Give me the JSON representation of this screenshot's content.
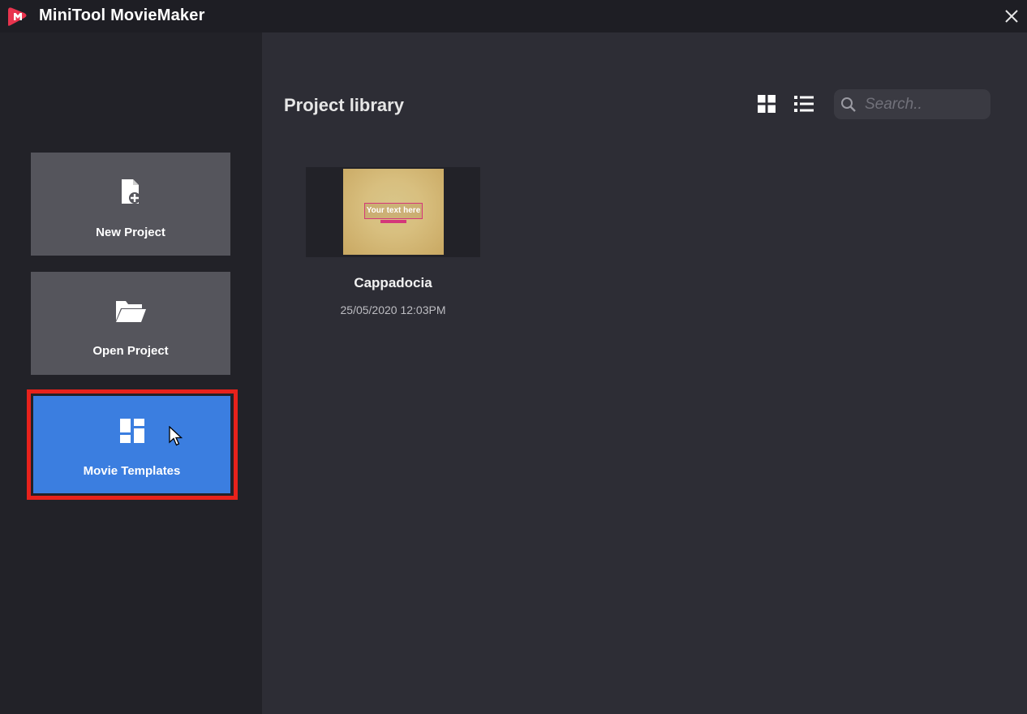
{
  "app": {
    "title": "MiniTool MovieMaker",
    "logo_icon": "minitool-logo-icon",
    "close_icon": "close-icon"
  },
  "sidebar": {
    "items": [
      {
        "label": "New Project",
        "icon": "new-file-icon"
      },
      {
        "label": "Open Project",
        "icon": "folder-icon"
      },
      {
        "label": "Movie Templates",
        "icon": "templates-icon",
        "selected": true
      }
    ]
  },
  "library": {
    "title": "Project library",
    "view_grid_icon": "grid-view-icon",
    "view_list_icon": "list-view-icon",
    "search": {
      "placeholder": "Search..",
      "value": ""
    },
    "projects": [
      {
        "name": "Cappadocia",
        "date": "25/05/2020  12:03PM",
        "thumbnail_text": "Your text here"
      }
    ]
  },
  "colors": {
    "titlebar": "#1e1e24",
    "sidebar": "#222228",
    "main": "#2d2d35",
    "button": "#55555c",
    "accent": "#3b7ee0",
    "highlight": "#e8221c"
  }
}
